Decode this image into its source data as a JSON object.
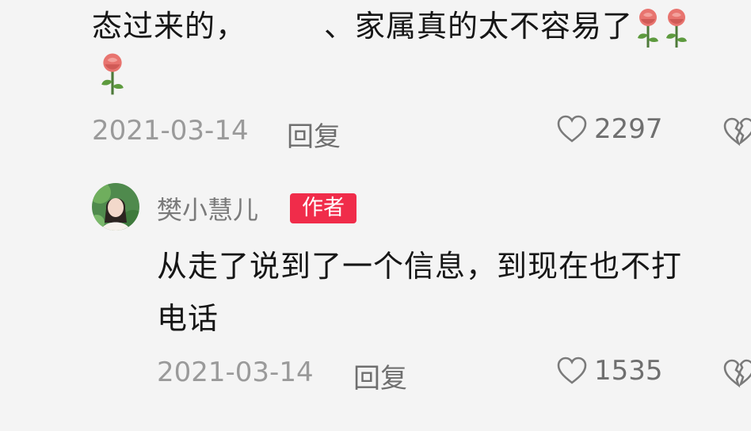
{
  "comment1": {
    "line1": "态过来的，　　　、家属真的太不容易了",
    "date": "2021-03-14",
    "reply_label": "回复",
    "like_count": "2297"
  },
  "comment2": {
    "author": "樊小慧儿",
    "badge": "作者",
    "line1": "从走了说到了一个信息，到现在也不打",
    "line2": "电话",
    "date": "2021-03-14",
    "reply_label": "回复",
    "like_count": "1535"
  },
  "icons": {
    "rose": "rose-emoji-icon",
    "like": "heart-outline-icon",
    "dislike": "broken-heart-icon"
  },
  "colors": {
    "badge": "#f02c4a",
    "text": "#161616",
    "meta": "#9a9a9a"
  }
}
